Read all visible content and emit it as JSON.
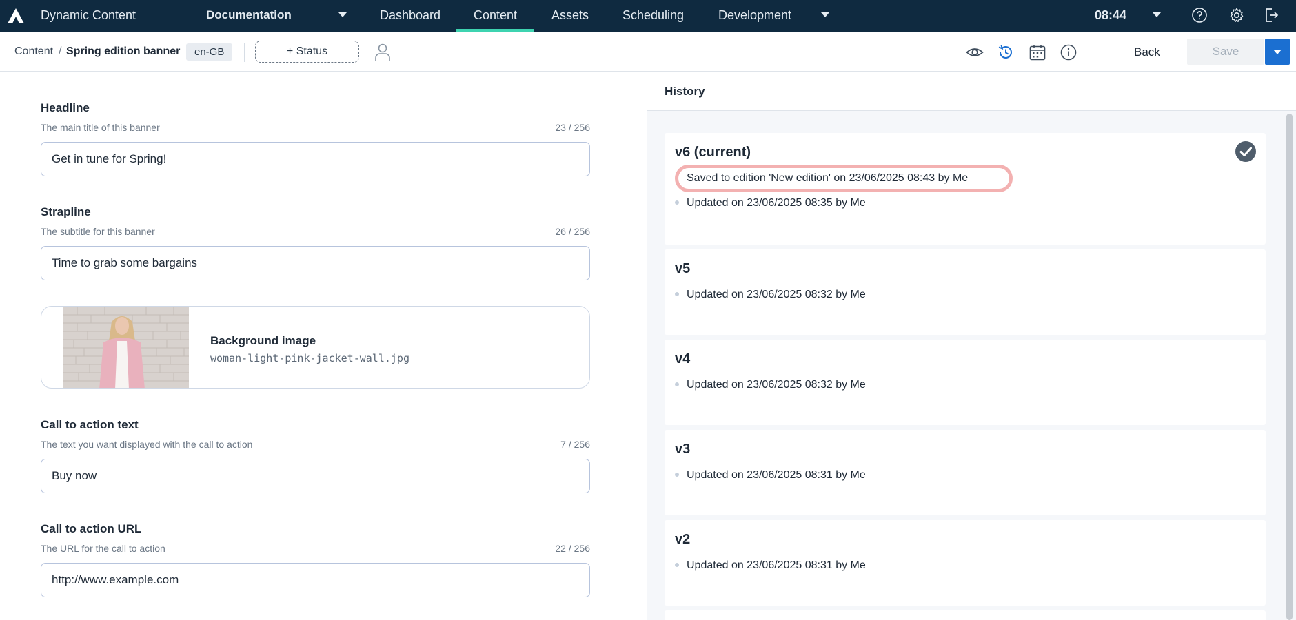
{
  "nav": {
    "app_title": "Dynamic Content",
    "hub": "Documentation",
    "items": [
      "Dashboard",
      "Content",
      "Assets",
      "Scheduling",
      "Development"
    ],
    "active": "Content",
    "time": "08:44",
    "icons": [
      "help-icon",
      "settings-icon",
      "logout-icon"
    ]
  },
  "toolbar": {
    "breadcrumb_root": "Content",
    "breadcrumb_sep": "/",
    "breadcrumb_current": "Spring edition banner",
    "locale": "en-GB",
    "status_button": "+ Status",
    "icons": [
      "preview-icon",
      "history-icon",
      "calendar-icon",
      "info-icon"
    ],
    "back_label": "Back",
    "save_label": "Save"
  },
  "form": {
    "headline": {
      "label": "Headline",
      "description": "The main title of this banner",
      "count": "23 / 256",
      "value": "Get in tune for Spring!"
    },
    "strapline": {
      "label": "Strapline",
      "description": "The subtitle for this banner",
      "count": "26 / 256",
      "value": "Time to grab some bargains"
    },
    "background_image": {
      "title": "Background image",
      "filename": "woman-light-pink-jacket-wall.jpg"
    },
    "cta_text": {
      "label": "Call to action text",
      "description": "The text you want displayed with the call to action",
      "count": "7 / 256",
      "value": "Buy now"
    },
    "cta_url": {
      "label": "Call to action URL",
      "description": "The URL for the call to action",
      "count": "22 / 256",
      "value": "http://www.example.com"
    }
  },
  "history": {
    "title": "History",
    "versions": [
      {
        "title": "v6 (current)",
        "entries": [
          "Saved to edition 'New edition' on 23/06/2025 08:43 by Me",
          "Updated on 23/06/2025 08:35 by Me"
        ],
        "current": true
      },
      {
        "title": "v5",
        "entries": [
          "Updated on 23/06/2025 08:32 by Me"
        ]
      },
      {
        "title": "v4",
        "entries": [
          "Updated on 23/06/2025 08:32 by Me"
        ]
      },
      {
        "title": "v3",
        "entries": [
          "Updated on 23/06/2025 08:31 by Me"
        ]
      },
      {
        "title": "v2",
        "entries": [
          "Updated on 23/06/2025 08:31 by Me"
        ]
      }
    ]
  },
  "colors": {
    "nav_bg": "#0f2a40",
    "nav_active": "#3ed3b0",
    "primary": "#1b6fd1",
    "highlight": "#f1a3a3"
  }
}
